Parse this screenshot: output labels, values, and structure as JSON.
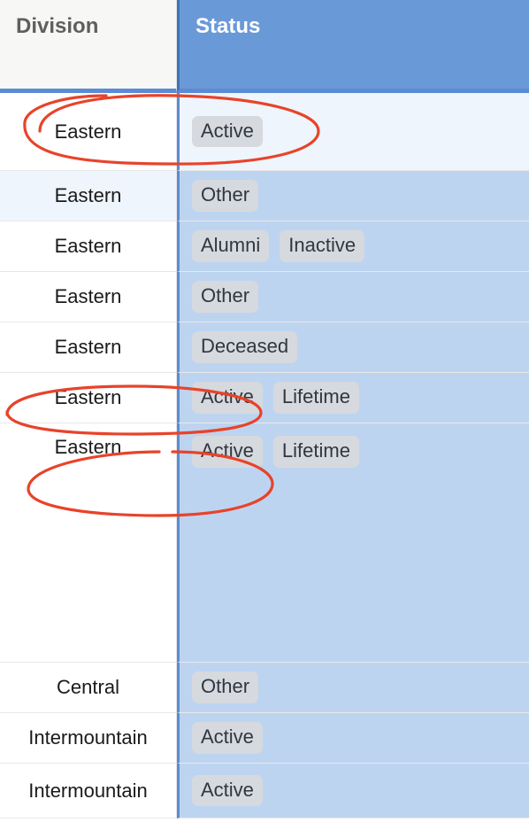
{
  "headers": {
    "division": "Division",
    "status": "Status"
  },
  "rows": [
    {
      "division": "Eastern",
      "statuses": [
        "Active"
      ]
    },
    {
      "division": "Eastern",
      "statuses": [
        "Other"
      ]
    },
    {
      "division": "Eastern",
      "statuses": [
        "Alumni",
        "Inactive"
      ]
    },
    {
      "division": "Eastern",
      "statuses": [
        "Other"
      ]
    },
    {
      "division": "Eastern",
      "statuses": [
        "Deceased"
      ]
    },
    {
      "division": "Eastern",
      "statuses": [
        "Active",
        "Lifetime"
      ]
    },
    {
      "division": "Eastern",
      "statuses": [
        "Active",
        "Lifetime"
      ]
    },
    {
      "division": "Central",
      "statuses": [
        "Other"
      ]
    },
    {
      "division": "Intermountain",
      "statuses": [
        "Active"
      ]
    },
    {
      "division": "Intermountain",
      "statuses": [
        "Active"
      ]
    }
  ]
}
